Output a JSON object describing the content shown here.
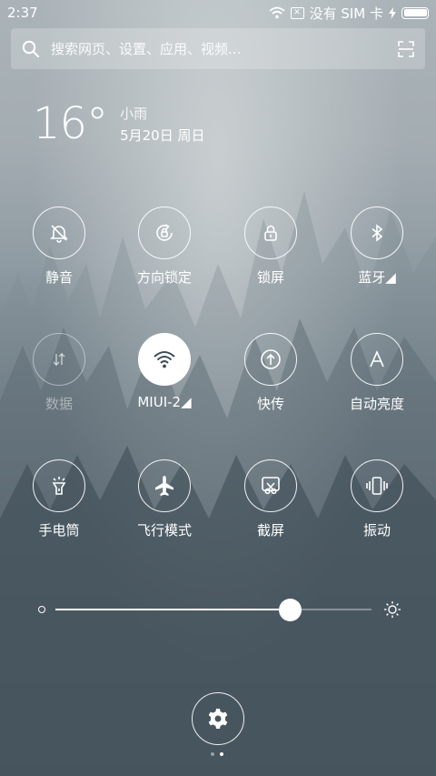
{
  "status_bar": {
    "time": "2:37",
    "carrier": "没有 SIM 卡",
    "icons": [
      "wifi-icon",
      "sim-icon",
      "charging-icon",
      "battery-icon"
    ]
  },
  "search": {
    "placeholder": "搜索网页、设置、应用、视频...",
    "icons": [
      "search-icon",
      "scan-icon"
    ]
  },
  "weather": {
    "temperature": "16°",
    "condition": "小雨",
    "date": "5月20日 周日"
  },
  "toggles": [
    {
      "label": "静音",
      "icon": "mute-bell-icon",
      "state": "off"
    },
    {
      "label": "方向锁定",
      "icon": "rotation-lock-icon",
      "state": "off"
    },
    {
      "label": "锁屏",
      "icon": "lock-icon",
      "state": "off"
    },
    {
      "label": "蓝牙◢",
      "icon": "bluetooth-icon",
      "state": "off"
    },
    {
      "label": "数据",
      "icon": "mobile-data-icon",
      "state": "disabled"
    },
    {
      "label": "MIUI-2◢",
      "icon": "wifi-icon",
      "state": "on"
    },
    {
      "label": "快传",
      "icon": "quick-transfer-icon",
      "state": "off"
    },
    {
      "label": "自动亮度",
      "icon": "auto-brightness-icon",
      "state": "off"
    },
    {
      "label": "手电筒",
      "icon": "flashlight-icon",
      "state": "off"
    },
    {
      "label": "飞行模式",
      "icon": "airplane-icon",
      "state": "off"
    },
    {
      "label": "截屏",
      "icon": "screenshot-icon",
      "state": "off"
    },
    {
      "label": "振动",
      "icon": "vibrate-icon",
      "state": "off"
    }
  ],
  "brightness": {
    "level": 0.74,
    "icons": [
      "brightness-low-icon",
      "brightness-high-icon"
    ]
  },
  "settings_button": {
    "icon": "gear-icon"
  },
  "page_indicator": {
    "total": 2,
    "current": 2
  },
  "colors": {
    "active_toggle_bg": "#ffffff",
    "active_toggle_icon": "#3d4a55"
  }
}
